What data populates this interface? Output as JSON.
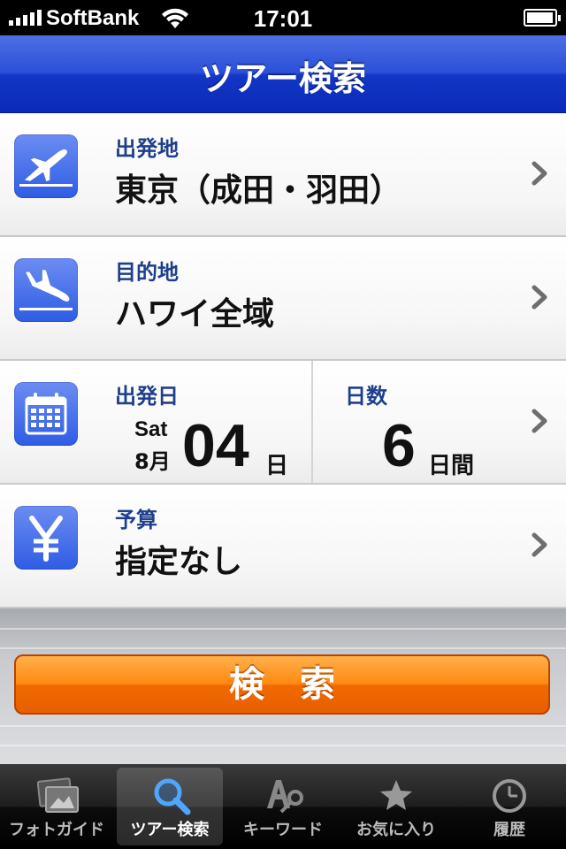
{
  "status_bar": {
    "carrier": "SoftBank",
    "time": "17:01",
    "battery_level": 0.95,
    "signal_bars": 5
  },
  "nav": {
    "title": "ツアー検索"
  },
  "rows": {
    "departure": {
      "label": "出発地",
      "value": "東京（成田・羽田）",
      "icon": "airplane-takeoff-icon"
    },
    "destination": {
      "label": "目的地",
      "value": "ハワイ全域",
      "icon": "airplane-landing-icon"
    },
    "date": {
      "label": "出発日",
      "day_of_week": "Sat",
      "month": "8月",
      "day": "04",
      "day_unit": "日",
      "icon": "calendar-icon"
    },
    "duration": {
      "label": "日数",
      "value": "6",
      "unit": "日間"
    },
    "budget": {
      "label": "予算",
      "value": "指定なし",
      "icon": "yen-icon"
    }
  },
  "search_button": {
    "label": "検索"
  },
  "tabs": [
    {
      "label": "フォトガイド",
      "icon": "photo-icon",
      "active": false
    },
    {
      "label": "ツアー検索",
      "icon": "magnifier-icon",
      "active": true
    },
    {
      "label": "キーワード",
      "icon": "keyword-key-icon",
      "active": false
    },
    {
      "label": "お気に入り",
      "icon": "star-icon",
      "active": false
    },
    {
      "label": "履歴",
      "icon": "clock-icon",
      "active": false
    }
  ],
  "colors": {
    "nav_blue": "#1336c7",
    "label_blue": "#1f3f8c",
    "icon_blue": "#2f5ce4",
    "button_orange": "#f06a00"
  }
}
